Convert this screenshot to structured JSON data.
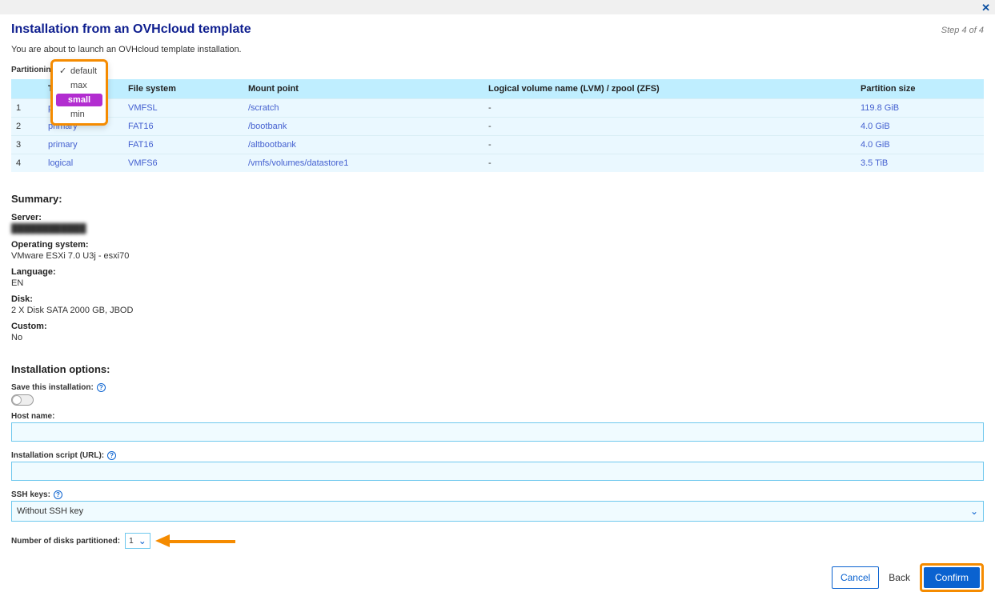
{
  "page": {
    "title": "Installation from an OVHcloud template",
    "step_text": "Step 4 of 4",
    "intro": "You are about to launch an OVHcloud template installation."
  },
  "partitioning": {
    "label": "Partitioning scheme:",
    "options": [
      "default",
      "max",
      "small",
      "min"
    ],
    "selected": "small"
  },
  "table": {
    "headers": {
      "type": "Type",
      "fs": "File system",
      "mount": "Mount point",
      "lvm": "Logical volume name (LVM) / zpool (ZFS)",
      "size": "Partition size"
    },
    "rows": [
      {
        "idx": "1",
        "type": "primary",
        "fs": "VMFSL",
        "mount": "/scratch",
        "lvm": "-",
        "size": "119.8 GiB"
      },
      {
        "idx": "2",
        "type": "primary",
        "fs": "FAT16",
        "mount": "/bootbank",
        "lvm": "-",
        "size": "4.0 GiB"
      },
      {
        "idx": "3",
        "type": "primary",
        "fs": "FAT16",
        "mount": "/altbootbank",
        "lvm": "-",
        "size": "4.0 GiB"
      },
      {
        "idx": "4",
        "type": "logical",
        "fs": "VMFS6",
        "mount": "/vmfs/volumes/datastore1",
        "lvm": "-",
        "size": "3.5 TiB"
      }
    ]
  },
  "summary": {
    "heading": "Summary:",
    "server_label": "Server:",
    "server_value": "████████████",
    "os_label": "Operating system:",
    "os_value": "VMware ESXi 7.0 U3j - esxi70",
    "lang_label": "Language:",
    "lang_value": "EN",
    "disk_label": "Disk:",
    "disk_value": "2 X Disk SATA 2000 GB, JBOD",
    "custom_label": "Custom:",
    "custom_value": "No"
  },
  "install_options": {
    "heading": "Installation options:",
    "save_label": "Save this installation:",
    "hostname_label": "Host name:",
    "hostname_value": "",
    "script_label": "Installation script (URL):",
    "script_value": "",
    "ssh_label": "SSH keys:",
    "ssh_value": "Without SSH key",
    "disks_label": "Number of disks partitioned:",
    "disks_value": "1"
  },
  "buttons": {
    "cancel": "Cancel",
    "back": "Back",
    "confirm": "Confirm"
  }
}
